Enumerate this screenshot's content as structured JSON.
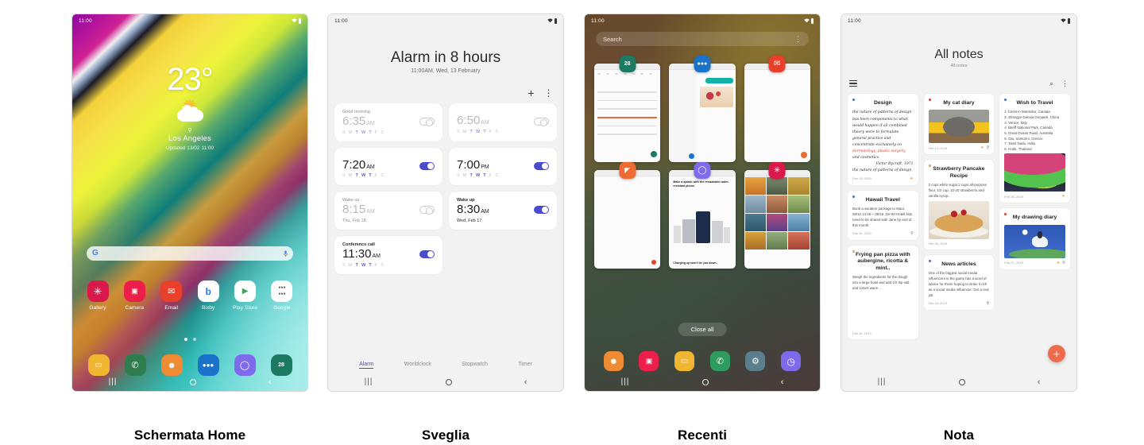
{
  "panels": [
    {
      "caption": "Schermata Home",
      "statusbar": {
        "time": "11:00",
        "wifi_icon": "wifi-icon",
        "battery_icon": "battery-icon"
      },
      "weather": {
        "temperature": "23°",
        "icon": "partly-sunny-icon",
        "location_pin_icon": "location-pin-icon",
        "city": "Los Angeles",
        "updated": "Updated 13/02 11:00"
      },
      "search": {
        "logo": "google-g-logo",
        "placeholder": "",
        "mic_icon": "microphone-icon"
      },
      "apps": [
        {
          "label": "Gallery",
          "icon": "gallery-icon",
          "glyph": "✳",
          "bg": "#d9194a",
          "fg": "#ffffff"
        },
        {
          "label": "Camera",
          "icon": "camera-icon",
          "glyph": "◉",
          "bg": "#ec1f4a",
          "fg": "#ffffff"
        },
        {
          "label": "Email",
          "icon": "email-icon",
          "glyph": "✉",
          "bg": "#e8402a",
          "fg": "#ffffff"
        },
        {
          "label": "Bixby",
          "icon": "bixby-icon",
          "glyph": "b",
          "bg": "#ffffff",
          "fg": "#2c7ae0"
        },
        {
          "label": "Play Store",
          "icon": "play-store-icon",
          "glyph": "▶",
          "bg": "#ffffff",
          "fg": "#34a853"
        },
        {
          "label": "Google",
          "icon": "google-folder-icon",
          "glyph": "",
          "bg": "#ffffff",
          "fg": "#444444"
        }
      ],
      "page_dots": {
        "total": 2,
        "active": 1
      },
      "dock": [
        {
          "label": "My Files",
          "icon": "my-files-icon",
          "glyph": "▭",
          "bg": "#f0b531",
          "fg": "#ffffff"
        },
        {
          "label": "Phone",
          "icon": "phone-icon",
          "glyph": "✆",
          "bg": "#2e7d4f",
          "fg": "#ffffff"
        },
        {
          "label": "Contacts",
          "icon": "contacts-icon",
          "glyph": "●",
          "bg": "#ef8b33",
          "fg": "#ffffff"
        },
        {
          "label": "Messages",
          "icon": "messages-icon",
          "glyph": "●●●",
          "bg": "#1a73c8",
          "fg": "#ffffff"
        },
        {
          "label": "Internet",
          "icon": "internet-icon",
          "glyph": "◯",
          "bg": "#7e6bec",
          "fg": "#ffffff"
        },
        {
          "label": "Calendar",
          "icon": "calendar-icon",
          "glyph": "28",
          "bg": "#1d7a62",
          "fg": "#ffffff"
        }
      ],
      "navbar": {
        "recents_icon": "recents-icon",
        "home_icon": "home-icon",
        "back_icon": "back-icon"
      }
    },
    {
      "caption": "Sveglia",
      "statusbar": {
        "time": "11:00",
        "wifi_icon": "wifi-icon",
        "battery_icon": "battery-icon"
      },
      "title": "Alarm in 8 hours",
      "subtitle": "11:00AM, Wed, 13 February",
      "add_icon": "plus-icon",
      "more_icon": "more-options-icon",
      "alarms": [
        {
          "name": "Good morning",
          "time": "6:35",
          "meridiem": "AM",
          "days": "SMTWTFS",
          "active_days": [
            2,
            3,
            4
          ],
          "enabled": false
        },
        {
          "name": "",
          "time": "6:50",
          "meridiem": "AM",
          "days": "SMTWTFS",
          "active_days": [
            2,
            3,
            4
          ],
          "enabled": false
        },
        {
          "name": "",
          "time": "7:20",
          "meridiem": "AM",
          "days": "SMTWTFS",
          "active_days": [
            2,
            3,
            4
          ],
          "enabled": true
        },
        {
          "name": "",
          "time": "7:00",
          "meridiem": "PM",
          "days": "SMTWTFS",
          "active_days": [
            2,
            3,
            4
          ],
          "enabled": true
        },
        {
          "name": "Wake up",
          "time": "8:15",
          "meridiem": "AM",
          "date": "Thu, Feb 18",
          "enabled": false
        },
        {
          "name": "Wake up",
          "time": "8:30",
          "meridiem": "AM",
          "date": "Wed, Feb 17",
          "enabled": true
        },
        {
          "name": "Conference call",
          "time": "11:30",
          "meridiem": "AM",
          "days": "SMTWTFS",
          "active_days": [
            2,
            3,
            4
          ],
          "enabled": true
        }
      ],
      "tabs": [
        {
          "label": "Alarm",
          "active": true
        },
        {
          "label": "Worldclock",
          "active": false
        },
        {
          "label": "Stopwatch",
          "active": false
        },
        {
          "label": "Timer",
          "active": false
        }
      ],
      "navbar": {
        "recents_icon": "recents-icon",
        "home_icon": "home-icon",
        "back_icon": "back-icon"
      }
    },
    {
      "caption": "Recenti",
      "statusbar": {
        "time": "11:00",
        "wifi_icon": "wifi-icon",
        "battery_icon": "battery-icon"
      },
      "search": {
        "placeholder": "Search",
        "more_icon": "more-options-icon"
      },
      "cards": [
        {
          "app": "Calendar",
          "icon": "calendar-icon",
          "glyph": "28",
          "bg": "#1d7a62",
          "kind": "calendar"
        },
        {
          "app": "Messages",
          "icon": "messages-icon",
          "glyph": "●●●",
          "bg": "#1a73c8",
          "kind": "messages"
        },
        {
          "app": "Email",
          "icon": "email-icon",
          "glyph": "✉",
          "bg": "#e8402a",
          "kind": "email"
        },
        {
          "app": "Notes",
          "icon": "notes-icon",
          "glyph": "◤",
          "bg": "#ef6b33",
          "kind": "notes"
        },
        {
          "app": "Internet",
          "icon": "internet-icon",
          "glyph": "◯",
          "bg": "#7e6bec",
          "kind": "web",
          "headline": "Make a splash with the remarkable water-resistant phone.",
          "subline": "Charging up won't tie you down."
        },
        {
          "app": "Gallery",
          "icon": "gallery-icon",
          "glyph": "✳",
          "bg": "#d9194a",
          "kind": "gallery"
        }
      ],
      "close_all": "Close all",
      "dock": [
        {
          "label": "Contacts",
          "icon": "contacts-icon",
          "glyph": "●",
          "bg": "#ef8b33",
          "fg": "#ffffff"
        },
        {
          "label": "Camera",
          "icon": "camera-icon",
          "glyph": "◉",
          "bg": "#ec1f4a",
          "fg": "#ffffff"
        },
        {
          "label": "My Files",
          "icon": "my-files-icon",
          "glyph": "▭",
          "bg": "#f0b531",
          "fg": "#ffffff"
        },
        {
          "label": "Phone",
          "icon": "phone-icon",
          "glyph": "✆",
          "bg": "#2e9b5f",
          "fg": "#ffffff"
        },
        {
          "label": "Settings",
          "icon": "settings-icon",
          "glyph": "⚙",
          "bg": "#5c7f8e",
          "fg": "#ffffff"
        },
        {
          "label": "Clock",
          "icon": "clock-icon",
          "glyph": "◷",
          "bg": "#7e6bec",
          "fg": "#ffffff"
        }
      ],
      "navbar": {
        "recents_icon": "recents-icon",
        "home_icon": "home-icon",
        "back_icon": "back-icon"
      }
    },
    {
      "caption": "Nota",
      "statusbar": {
        "time": "11:00",
        "wifi_icon": "wifi-icon",
        "battery_icon": "battery-icon"
      },
      "title": "All notes",
      "count": "48 notes",
      "menu_icon": "hamburger-menu-icon",
      "search_icon": "search-icon",
      "more_icon": "more-options-icon",
      "add_icon": "plus-icon",
      "notes": [
        {
          "column": 0,
          "title": "Design",
          "tag_color": "#3b6fd4",
          "kind": "handwriting",
          "handwriting": [
            "the nature of patterns of design",
            "has been components to what",
            "would happen if all combined",
            "theory were to formulate",
            "general practice and",
            "concentrate exclusively on",
            "dermatology, plastic surgery,",
            "and cosmetics.",
            "Victor Bycraft, 1971",
            "the nature of patterns of design"
          ],
          "date": "Feb 13, 2019",
          "star": true
        },
        {
          "column": 0,
          "title": "Hawaii Travel",
          "tag_color": "#3b6fd4",
          "kind": "text",
          "body": "Book a vacation  package to Maui. 08/10 13:45 ~ 08/15 ,15! 50 Hotell lists need to be shared with Jane by end of this month",
          "date": "Feb 15, 2019",
          "pin": true
        },
        {
          "column": 0,
          "title": "Frying pan pizza with aubergine, ricotta & mint..",
          "tag_color": "#f0a926",
          "kind": "text-image",
          "body": "Weigh the ingredients for the dough into a large bowl and add 1/2 tsp salt and 125ml warm ..",
          "image": "pizza-photo",
          "date": "Feb 16, 2019"
        },
        {
          "column": 1,
          "title": "My cat diary",
          "tag_color": "#e0392b",
          "kind": "image",
          "image": "cat-photo",
          "date": "Feb 19, 2019",
          "star": true,
          "pin": true
        },
        {
          "column": 1,
          "title": "Strawberry Pancake Recipe",
          "tag_color": "#f0a926",
          "kind": "text-image",
          "body": "2 cups white sugar,2 cups all-purpose flour, 1/2 cup, 10-20 strawberris and vanilla syrup..",
          "image": "pancake-photo",
          "date": "Feb 20, 2019"
        },
        {
          "column": 1,
          "title": "News articles",
          "tag_color": "#3b6fd4",
          "kind": "text",
          "body": "One of the biggest social media influencers in the game has a word of advice for those hoping to strike it rich as a social media influencer: Get a real job",
          "date": "Feb 24, 2019",
          "pin": true
        },
        {
          "column": 2,
          "title": "Wish to Travel",
          "tag_color": "#3b6fd4",
          "kind": "list-image",
          "list": [
            "1. forest in Manitoba, Canada",
            "2. Zhangye Danxia Geopark, China",
            "3. Venice, Italy",
            "4. Banff National Park, Canada",
            "5. Great Ocean Road, Australia",
            "6. Oia, Santorini, Greece",
            "7. Tamil Nadu, India",
            "8. Krabi, Thailand"
          ],
          "image": "aurora-photo",
          "date": "Feb 26, 2019",
          "star": true
        },
        {
          "column": 2,
          "title": "My drawing diary",
          "tag_color": "#e0392b",
          "kind": "image",
          "image": "drawing-horse",
          "date": "Feb 27, 2019",
          "star": true,
          "pin": true
        }
      ],
      "navbar": {
        "recents_icon": "recents-icon",
        "home_icon": "home-icon",
        "back_icon": "back-icon"
      }
    }
  ],
  "colors": {
    "accent_blue": "#4b4bd2",
    "fab_orange": "#ef6b4e",
    "star_gold": "#f0a926"
  }
}
